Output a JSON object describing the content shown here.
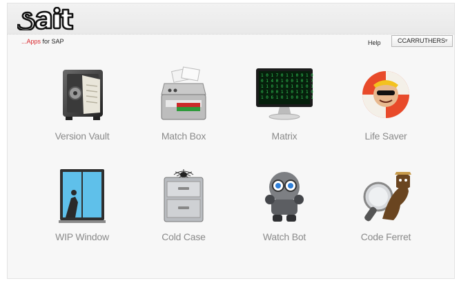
{
  "header": {
    "logo_text": "sait",
    "tagline_accent": "...Apps",
    "tagline_rest": " for SAP",
    "help_label": "Help",
    "user_label": "CCARRUTHERS"
  },
  "apps": [
    {
      "label": "Version Vault",
      "icon": "vault-icon"
    },
    {
      "label": "Match Box",
      "icon": "matchbox-icon"
    },
    {
      "label": "Matrix",
      "icon": "monitor-icon"
    },
    {
      "label": "Life Saver",
      "icon": "lifesaver-icon"
    },
    {
      "label": "WIP Window",
      "icon": "window-icon"
    },
    {
      "label": "Cold Case",
      "icon": "filing-cabinet-icon"
    },
    {
      "label": "Watch Bot",
      "icon": "robot-icon"
    },
    {
      "label": "Code Ferret",
      "icon": "ferret-icon"
    }
  ],
  "colors": {
    "accent": "#d9252a",
    "label": "#8a8a8a"
  }
}
